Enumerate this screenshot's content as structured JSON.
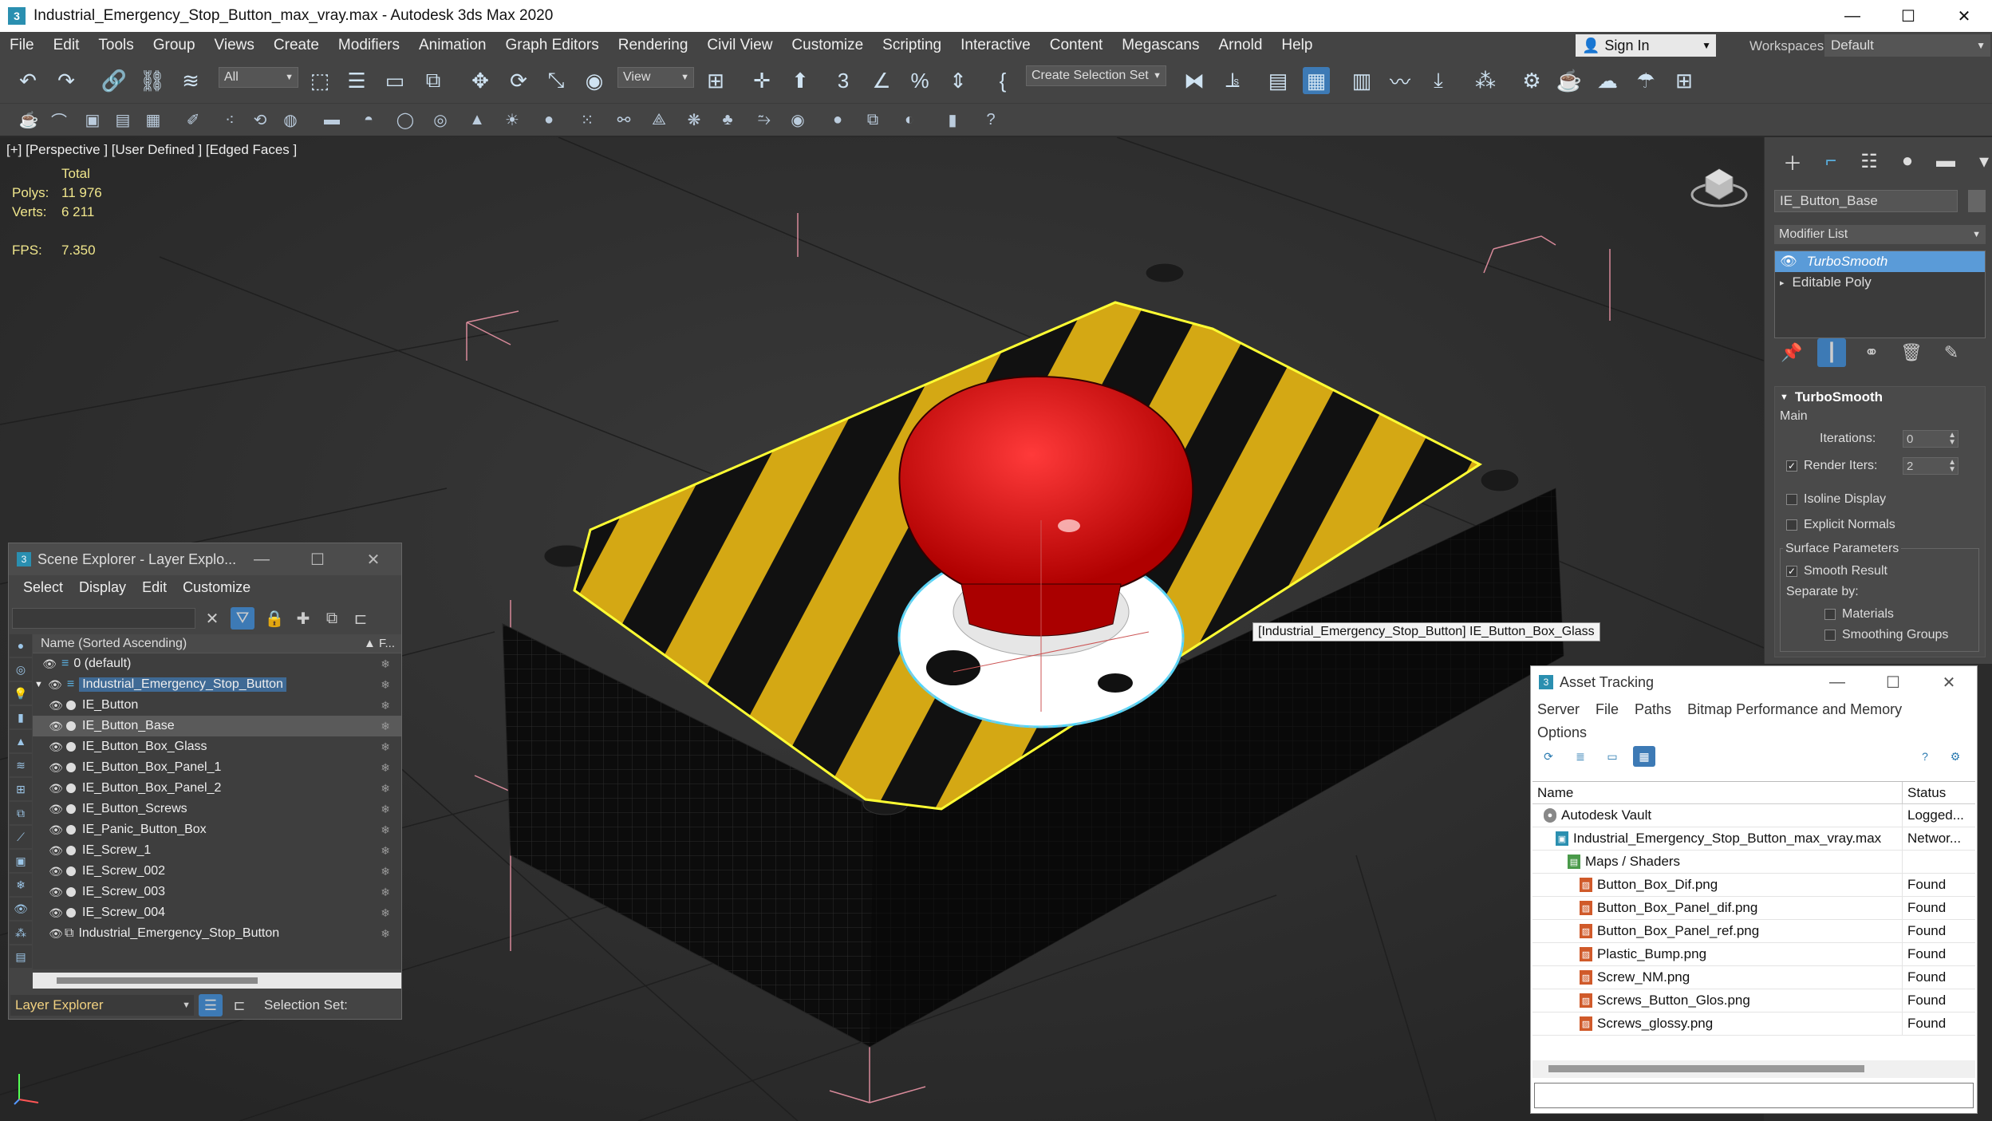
{
  "window": {
    "title": "Industrial_Emergency_Stop_Button_max_vray.max - Autodesk 3ds Max 2020",
    "app_icon": "3",
    "controls": [
      "—",
      "☐",
      "✕"
    ]
  },
  "menu": [
    "File",
    "Edit",
    "Tools",
    "Group",
    "Views",
    "Create",
    "Modifiers",
    "Animation",
    "Graph Editors",
    "Rendering",
    "Civil View",
    "Customize",
    "Scripting",
    "Interactive",
    "Content",
    "Megascans",
    "Arnold",
    "Help"
  ],
  "signin": {
    "label": "Sign In"
  },
  "workspaces": {
    "label": "Workspaces:",
    "value": "Default"
  },
  "toolbar": {
    "selection_filter": "All",
    "ref_coord": "View",
    "selection_set_placeholder": "Create Selection Set"
  },
  "viewport": {
    "label": "[+] [Perspective ] [User Defined ] [Edged Faces ]",
    "stats": {
      "total_label": "Total",
      "polys_label": "Polys:",
      "polys": "11 976",
      "verts_label": "Verts:",
      "verts": "6 211",
      "fps_label": "FPS:",
      "fps": "7.350"
    },
    "tooltip": "[Industrial_Emergency_Stop_Button] IE_Button_Box_Glass"
  },
  "command_panel": {
    "object_name": "IE_Button_Base",
    "modifier_list": "Modifier List",
    "stack": [
      "TurboSmooth",
      "Editable Poly"
    ],
    "rollout": {
      "title": "TurboSmooth",
      "main": "Main",
      "iterations_label": "Iterations:",
      "iterations": "0",
      "render_iters_label": "Render Iters:",
      "render_iters": "2",
      "isoline": "Isoline Display",
      "explicit": "Explicit Normals",
      "surface": "Surface Parameters",
      "smooth_result": "Smooth Result",
      "separate_by": "Separate by:",
      "materials": "Materials",
      "smoothing_groups": "Smoothing Groups"
    }
  },
  "scene_explorer": {
    "title": "Scene Explorer - Layer Explo...",
    "menu": [
      "Select",
      "Display",
      "Edit",
      "Customize"
    ],
    "header": "Name (Sorted Ascending)",
    "header_f": "▲ F...",
    "rows": [
      {
        "name": "0 (default)",
        "level": 0,
        "type": "layer"
      },
      {
        "name": "Industrial_Emergency_Stop_Button",
        "level": 0,
        "type": "layer",
        "highlight": true
      },
      {
        "name": "IE_Button",
        "level": 1,
        "type": "object"
      },
      {
        "name": "IE_Button_Base",
        "level": 1,
        "type": "object",
        "selected": true
      },
      {
        "name": "IE_Button_Box_Glass",
        "level": 1,
        "type": "object"
      },
      {
        "name": "IE_Button_Box_Panel_1",
        "level": 1,
        "type": "object"
      },
      {
        "name": "IE_Button_Box_Panel_2",
        "level": 1,
        "type": "object"
      },
      {
        "name": "IE_Button_Screws",
        "level": 1,
        "type": "object"
      },
      {
        "name": "IE_Panic_Button_Box",
        "level": 1,
        "type": "object"
      },
      {
        "name": "IE_Screw_1",
        "level": 1,
        "type": "object"
      },
      {
        "name": "IE_Screw_002",
        "level": 1,
        "type": "object"
      },
      {
        "name": "IE_Screw_003",
        "level": 1,
        "type": "object"
      },
      {
        "name": "IE_Screw_004",
        "level": 1,
        "type": "object"
      },
      {
        "name": "Industrial_Emergency_Stop_Button",
        "level": 1,
        "type": "group"
      }
    ],
    "bottom_layer": "Layer Explorer",
    "selection_set": "Selection Set:"
  },
  "asset_tracking": {
    "title": "Asset Tracking",
    "menu": [
      "Server",
      "File",
      "Paths",
      "Bitmap Performance and Memory"
    ],
    "menu2": "Options",
    "col_name": "Name",
    "col_status": "Status",
    "rows": [
      {
        "name": "Autodesk Vault",
        "status": "Logged...",
        "indent": 0,
        "icon": "vault"
      },
      {
        "name": "Industrial_Emergency_Stop_Button_max_vray.max",
        "status": "Networ...",
        "indent": 1,
        "icon": "max"
      },
      {
        "name": "Maps / Shaders",
        "status": "",
        "indent": 2,
        "icon": "folder"
      },
      {
        "name": "Button_Box_Dif.png",
        "status": "Found",
        "indent": 3,
        "icon": "png"
      },
      {
        "name": "Button_Box_Panel_dif.png",
        "status": "Found",
        "indent": 3,
        "icon": "png"
      },
      {
        "name": "Button_Box_Panel_ref.png",
        "status": "Found",
        "indent": 3,
        "icon": "png"
      },
      {
        "name": "Plastic_Bump.png",
        "status": "Found",
        "indent": 3,
        "icon": "png"
      },
      {
        "name": "Screw_NM.png",
        "status": "Found",
        "indent": 3,
        "icon": "png"
      },
      {
        "name": "Screws_Button_Glos.png",
        "status": "Found",
        "indent": 3,
        "icon": "png"
      },
      {
        "name": "Screws_glossy.png",
        "status": "Found",
        "indent": 3,
        "icon": "png"
      }
    ]
  },
  "colors": {
    "accent": "#5a9bd8",
    "selection_yellow": "#ffff33",
    "button_red": "#d81010",
    "stripe_yellow": "#d4a814"
  }
}
